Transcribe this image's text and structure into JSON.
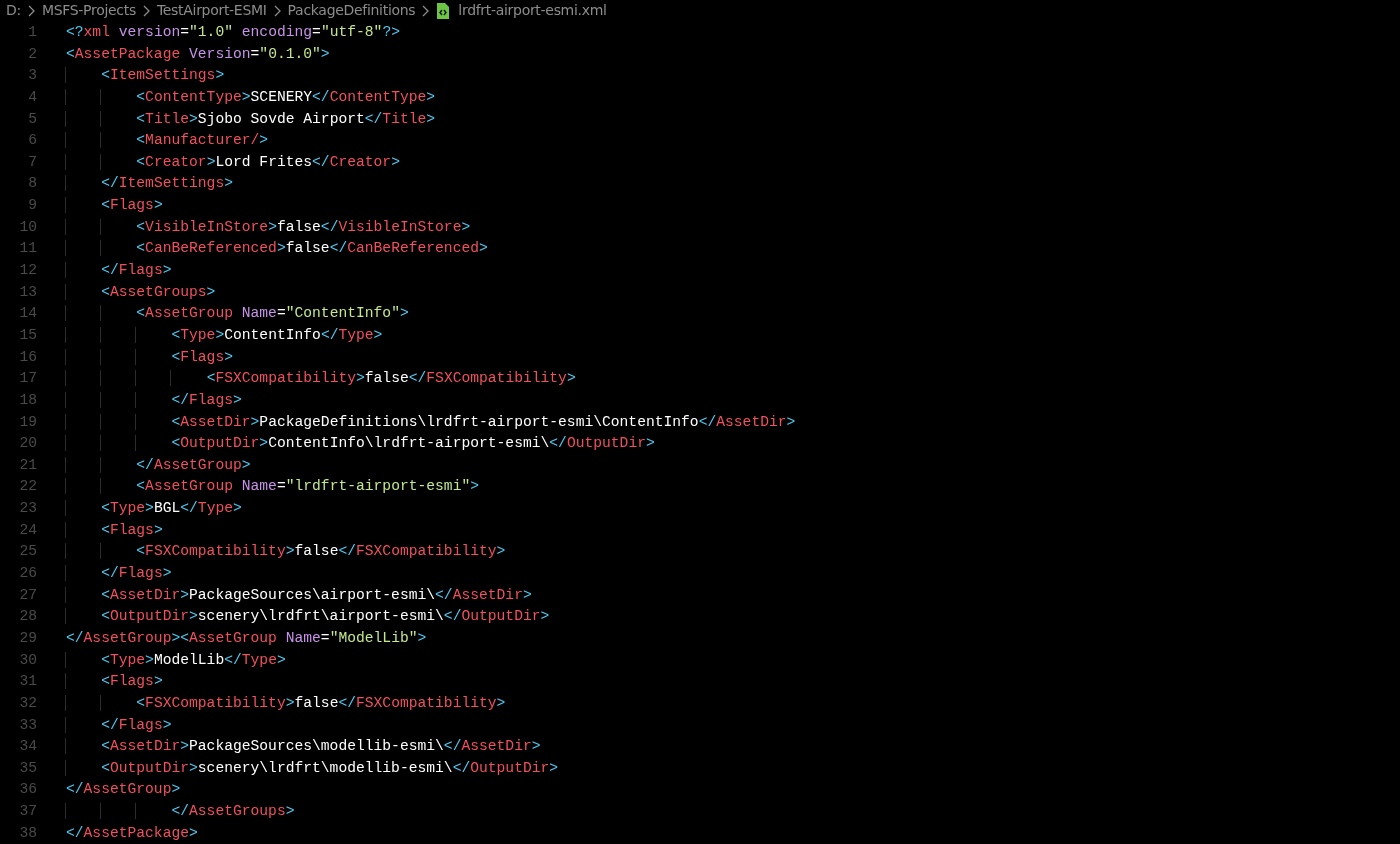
{
  "breadcrumb": [
    {
      "label": "D:",
      "kind": "folder"
    },
    {
      "label": "MSFS-Projects",
      "kind": "folder"
    },
    {
      "label": "TestAirport-ESMI",
      "kind": "folder"
    },
    {
      "label": "PackageDefinitions",
      "kind": "folder"
    },
    {
      "label": "lrdfrt-airport-esmi.xml",
      "kind": "file"
    }
  ],
  "editor": {
    "lines": [
      {
        "number": "1",
        "code": "<?xml version=\"1.0\" encoding=\"utf-8\"?>"
      },
      {
        "number": "2",
        "code": "<AssetPackage Version=\"0.1.0\">"
      },
      {
        "number": "3",
        "code": "    <ItemSettings>"
      },
      {
        "number": "4",
        "code": "        <ContentType>SCENERY</ContentType>"
      },
      {
        "number": "5",
        "code": "        <Title>Sjobo Sovde Airport</Title>"
      },
      {
        "number": "6",
        "code": "        <Manufacturer/>"
      },
      {
        "number": "7",
        "code": "        <Creator>Lord Frites</Creator>"
      },
      {
        "number": "8",
        "code": "    </ItemSettings>"
      },
      {
        "number": "9",
        "code": "    <Flags>"
      },
      {
        "number": "10",
        "code": "        <VisibleInStore>false</VisibleInStore>"
      },
      {
        "number": "11",
        "code": "        <CanBeReferenced>false</CanBeReferenced>"
      },
      {
        "number": "12",
        "code": "    </Flags>"
      },
      {
        "number": "13",
        "code": "    <AssetGroups>"
      },
      {
        "number": "14",
        "code": "        <AssetGroup Name=\"ContentInfo\">"
      },
      {
        "number": "15",
        "code": "            <Type>ContentInfo</Type>"
      },
      {
        "number": "16",
        "code": "            <Flags>"
      },
      {
        "number": "17",
        "code": "                <FSXCompatibility>false</FSXCompatibility>"
      },
      {
        "number": "18",
        "code": "            </Flags>"
      },
      {
        "number": "19",
        "code": "            <AssetDir>PackageDefinitions\\lrdfrt-airport-esmi\\ContentInfo</AssetDir>"
      },
      {
        "number": "20",
        "code": "            <OutputDir>ContentInfo\\lrdfrt-airport-esmi\\</OutputDir>"
      },
      {
        "number": "21",
        "code": "        </AssetGroup>"
      },
      {
        "number": "22",
        "code": "        <AssetGroup Name=\"lrdfrt-airport-esmi\">"
      },
      {
        "number": "23",
        "code": "    <Type>BGL</Type>"
      },
      {
        "number": "24",
        "code": "    <Flags>"
      },
      {
        "number": "25",
        "code": "        <FSXCompatibility>false</FSXCompatibility>"
      },
      {
        "number": "26",
        "code": "    </Flags>"
      },
      {
        "number": "27",
        "code": "    <AssetDir>PackageSources\\airport-esmi\\</AssetDir>"
      },
      {
        "number": "28",
        "code": "    <OutputDir>scenery\\lrdfrt\\airport-esmi\\</OutputDir>"
      },
      {
        "number": "29",
        "code": "</AssetGroup><AssetGroup Name=\"ModelLib\">"
      },
      {
        "number": "30",
        "code": "    <Type>ModelLib</Type>"
      },
      {
        "number": "31",
        "code": "    <Flags>"
      },
      {
        "number": "32",
        "code": "        <FSXCompatibility>false</FSXCompatibility>"
      },
      {
        "number": "33",
        "code": "    </Flags>"
      },
      {
        "number": "34",
        "code": "    <AssetDir>PackageSources\\modellib-esmi\\</AssetDir>"
      },
      {
        "number": "35",
        "code": "    <OutputDir>scenery\\lrdfrt\\modellib-esmi\\</OutputDir>"
      },
      {
        "number": "36",
        "code": "</AssetGroup>"
      },
      {
        "number": "37",
        "code": "            </AssetGroups>"
      },
      {
        "number": "38",
        "code": "</AssetPackage>"
      }
    ]
  }
}
